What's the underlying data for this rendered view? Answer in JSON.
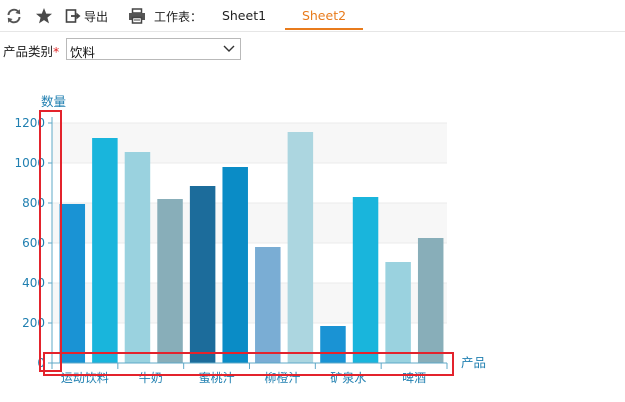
{
  "toolbar": {
    "refresh_icon": "refresh-icon",
    "favorite_icon": "star-icon",
    "export_label": "导出",
    "print_icon": "printer-icon",
    "sheet_label": "工作表：",
    "tabs": [
      {
        "label": "Sheet1",
        "active": false
      },
      {
        "label": "Sheet2",
        "active": true
      }
    ]
  },
  "filter": {
    "label": "产品类别",
    "required_mark": "*",
    "value": "饮料"
  },
  "chart_data": {
    "type": "bar",
    "ylabel": "数量",
    "xlabel": "产品",
    "ylim": [
      0,
      1200
    ],
    "y_ticks": [
      0,
      200,
      400,
      600,
      800,
      1000,
      1200
    ],
    "x_tick_labels": [
      "运动饮料",
      "牛奶",
      "蜜桃汁",
      "柳橙汁",
      "矿泉水",
      "啤酒"
    ],
    "values": [
      795,
      1125,
      1055,
      820,
      885,
      980,
      580,
      1155,
      185,
      830,
      505,
      625
    ],
    "colors": [
      "#1a93d4",
      "#19b5dc",
      "#9ad2df",
      "#88aeb9",
      "#1c6c9b",
      "#0a8cc6",
      "#7aadd4",
      "#acd6e0",
      "#1a93d4",
      "#19b5dc",
      "#9ad2df",
      "#88aeb9"
    ],
    "grid": true,
    "legend": "none"
  }
}
